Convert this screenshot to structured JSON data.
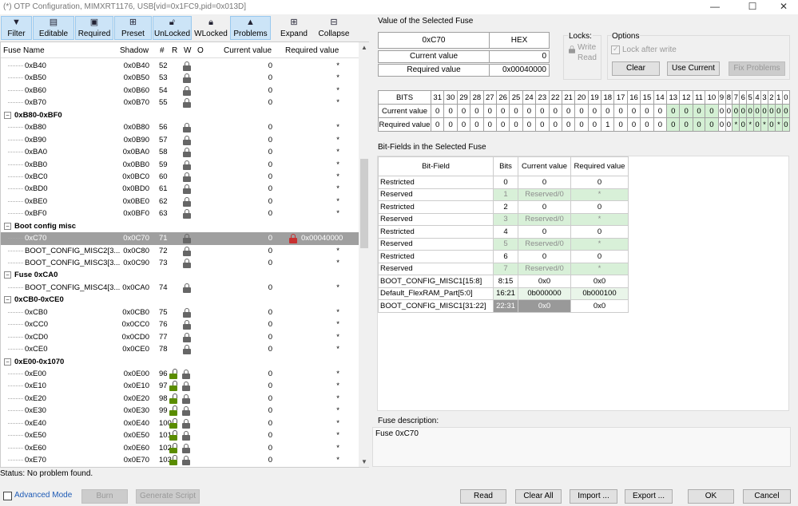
{
  "window": {
    "title": "(*) OTP Configuration, MIMXRT1176, USB[vid=0x1FC9,pid=0x013D]",
    "min": "—",
    "max": "☐",
    "close": "✕"
  },
  "toolbar": {
    "filter": "Filter",
    "editable": "Editable",
    "required": "Required",
    "preset": "Preset",
    "unlocked": "UnLocked",
    "wlocked": "WLocked",
    "problems": "Problems",
    "expand": "Expand",
    "collapse": "Collapse"
  },
  "left": {
    "headers": {
      "name": "Fuse Name",
      "shadow": "Shadow",
      "num": "#",
      "r": "R",
      "w": "W",
      "o": "O",
      "current": "Current value",
      "required": "Required value"
    },
    "rows": [
      {
        "type": "item",
        "name": "0xB40",
        "shadow": "0x0B40",
        "num": "52",
        "lock": "g0",
        "cur": "0",
        "req": "*"
      },
      {
        "type": "item",
        "name": "0xB50",
        "shadow": "0x0B50",
        "num": "53",
        "lock": "g0",
        "cur": "0",
        "req": "*"
      },
      {
        "type": "item",
        "name": "0xB60",
        "shadow": "0x0B60",
        "num": "54",
        "lock": "g0",
        "cur": "0",
        "req": "*"
      },
      {
        "type": "item",
        "name": "0xB70",
        "shadow": "0x0B70",
        "num": "55",
        "lock": "g0",
        "cur": "0",
        "req": "*"
      },
      {
        "type": "group",
        "name": "0xB80-0xBF0"
      },
      {
        "type": "item",
        "name": "0xB80",
        "shadow": "0x0B80",
        "num": "56",
        "lock": "g0",
        "cur": "0",
        "req": "*"
      },
      {
        "type": "item",
        "name": "0xB90",
        "shadow": "0x0B90",
        "num": "57",
        "lock": "g0",
        "cur": "0",
        "req": "*"
      },
      {
        "type": "item",
        "name": "0xBA0",
        "shadow": "0x0BA0",
        "num": "58",
        "lock": "g0",
        "cur": "0",
        "req": "*"
      },
      {
        "type": "item",
        "name": "0xBB0",
        "shadow": "0x0BB0",
        "num": "59",
        "lock": "g0",
        "cur": "0",
        "req": "*"
      },
      {
        "type": "item",
        "name": "0xBC0",
        "shadow": "0x0BC0",
        "num": "60",
        "lock": "g0",
        "cur": "0",
        "req": "*"
      },
      {
        "type": "item",
        "name": "0xBD0",
        "shadow": "0x0BD0",
        "num": "61",
        "lock": "g0",
        "cur": "0",
        "req": "*"
      },
      {
        "type": "item",
        "name": "0xBE0",
        "shadow": "0x0BE0",
        "num": "62",
        "lock": "g0",
        "cur": "0",
        "req": "*"
      },
      {
        "type": "item",
        "name": "0xBF0",
        "shadow": "0x0BF0",
        "num": "63",
        "lock": "g0",
        "cur": "0",
        "req": "*"
      },
      {
        "type": "group",
        "name": "Boot config misc"
      },
      {
        "type": "sel",
        "name": "0xC70",
        "shadow": "0x0C70",
        "num": "71",
        "lock": "g0",
        "cur": "0",
        "req": "0x00040000"
      },
      {
        "type": "item",
        "name": "BOOT_CONFIG_MISC2[3...",
        "shadow": "0x0C80",
        "num": "72",
        "lock": "g0",
        "cur": "0",
        "req": "*"
      },
      {
        "type": "item",
        "name": "BOOT_CONFIG_MISC3[3...",
        "shadow": "0x0C90",
        "num": "73",
        "lock": "g0",
        "cur": "0",
        "req": "*"
      },
      {
        "type": "group",
        "name": "Fuse 0xCA0"
      },
      {
        "type": "item",
        "name": "BOOT_CONFIG_MISC4[3...",
        "shadow": "0x0CA0",
        "num": "74",
        "lock": "g0",
        "cur": "0",
        "req": "*"
      },
      {
        "type": "group",
        "name": "0xCB0-0xCE0"
      },
      {
        "type": "item",
        "name": "0xCB0",
        "shadow": "0x0CB0",
        "num": "75",
        "lock": "g0",
        "cur": "0",
        "req": "*"
      },
      {
        "type": "item",
        "name": "0xCC0",
        "shadow": "0x0CC0",
        "num": "76",
        "lock": "g0",
        "cur": "0",
        "req": "*"
      },
      {
        "type": "item",
        "name": "0xCD0",
        "shadow": "0x0CD0",
        "num": "77",
        "lock": "g0",
        "cur": "0",
        "req": "*"
      },
      {
        "type": "item",
        "name": "0xCE0",
        "shadow": "0x0CE0",
        "num": "78",
        "lock": "g0",
        "cur": "0",
        "req": "*"
      },
      {
        "type": "group",
        "name": "0xE00-0x1070"
      },
      {
        "type": "item",
        "name": "0xE00",
        "shadow": "0x0E00",
        "num": "96",
        "lock": "g1",
        "cur": "0",
        "req": "*"
      },
      {
        "type": "item",
        "name": "0xE10",
        "shadow": "0x0E10",
        "num": "97",
        "lock": "g1",
        "cur": "0",
        "req": "*"
      },
      {
        "type": "item",
        "name": "0xE20",
        "shadow": "0x0E20",
        "num": "98",
        "lock": "g1",
        "cur": "0",
        "req": "*"
      },
      {
        "type": "item",
        "name": "0xE30",
        "shadow": "0x0E30",
        "num": "99",
        "lock": "g1",
        "cur": "0",
        "req": "*"
      },
      {
        "type": "item",
        "name": "0xE40",
        "shadow": "0x0E40",
        "num": "100",
        "lock": "g1",
        "cur": "0",
        "req": "*"
      },
      {
        "type": "item",
        "name": "0xE50",
        "shadow": "0x0E50",
        "num": "101",
        "lock": "g1",
        "cur": "0",
        "req": "*"
      },
      {
        "type": "item",
        "name": "0xE60",
        "shadow": "0x0E60",
        "num": "102",
        "lock": "g1",
        "cur": "0",
        "req": "*"
      },
      {
        "type": "item",
        "name": "0xE70",
        "shadow": "0x0E70",
        "num": "103",
        "lock": "g1",
        "cur": "0",
        "req": "*"
      }
    ]
  },
  "selected": {
    "group_title": "Value of the Selected Fuse",
    "address": "0xC70",
    "format": "HEX",
    "current_label": "Current value",
    "current_value": "0",
    "required_label": "Required value",
    "required_value": "0x00040000"
  },
  "locks": {
    "title": "Locks:",
    "write": "Write",
    "read": "Read"
  },
  "options": {
    "title": "Options",
    "lock_after_write": "Lock after write",
    "clear": "Clear",
    "use_current": "Use Current",
    "fix_problems": "Fix Problems"
  },
  "bits": {
    "label": "BITS",
    "current_label": "Current value",
    "required_label": "Required value",
    "numbers": [
      "31",
      "30",
      "29",
      "28",
      "27",
      "26",
      "25",
      "24",
      "23",
      "22",
      "21",
      "20",
      "19",
      "18",
      "17",
      "16",
      "15",
      "14",
      "13",
      "12",
      "11",
      "10",
      "9",
      "8",
      "7",
      "6",
      "5",
      "4",
      "3",
      "2",
      "1",
      "0"
    ],
    "current": [
      "0",
      "0",
      "0",
      "0",
      "0",
      "0",
      "0",
      "0",
      "0",
      "0",
      "0",
      "0",
      "0",
      "0",
      "0",
      "0",
      "0",
      "0",
      "0",
      "0",
      "0",
      "0",
      "0",
      "0",
      "0",
      "0",
      "0",
      "0",
      "0",
      "0",
      "0",
      "0"
    ],
    "required": [
      "0",
      "0",
      "0",
      "0",
      "0",
      "0",
      "0",
      "0",
      "0",
      "0",
      "0",
      "0",
      "0",
      "1",
      "0",
      "0",
      "0",
      "0",
      "0",
      "0",
      "0",
      "0",
      "0",
      "0",
      "*",
      "0",
      "*",
      "0",
      "*",
      "0",
      "*",
      "0"
    ]
  },
  "bitfields": {
    "title": "Bit-Fields in the Selected Fuse",
    "headers": [
      "Bit-Field",
      "Bits",
      "Current value",
      "Required value"
    ],
    "rows": [
      {
        "style": "",
        "name": "Restricted",
        "bits": "0",
        "cur": "0",
        "req": "0"
      },
      {
        "style": "rz",
        "name": "Reserved",
        "bits": "1",
        "cur": "Reserved/0",
        "req": "*"
      },
      {
        "style": "",
        "name": "Restricted",
        "bits": "2",
        "cur": "0",
        "req": "0"
      },
      {
        "style": "rz",
        "name": "Reserved",
        "bits": "3",
        "cur": "Reserved/0",
        "req": "*"
      },
      {
        "style": "",
        "name": "Restricted",
        "bits": "4",
        "cur": "0",
        "req": "0"
      },
      {
        "style": "rz",
        "name": "Reserved",
        "bits": "5",
        "cur": "Reserved/0",
        "req": "*"
      },
      {
        "style": "",
        "name": "Restricted",
        "bits": "6",
        "cur": "0",
        "req": "0"
      },
      {
        "style": "rz",
        "name": "Reserved",
        "bits": "7",
        "cur": "Reserved/0",
        "req": "*"
      },
      {
        "style": "",
        "name": "BOOT_CONFIG_MISC1[15:8]",
        "bits": "8:15",
        "cur": "0x0",
        "req": "0x0"
      },
      {
        "style": "dk",
        "name": "Default_FlexRAM_Part[5:0]",
        "bits": "16:21",
        "cur": "0b000000",
        "req": "0b000100"
      },
      {
        "style": "gy",
        "name": "BOOT_CONFIG_MISC1[31:22]",
        "bits": "22:31",
        "cur": "0x0",
        "req": "0x0"
      }
    ]
  },
  "description": {
    "title": "Fuse description:",
    "text": "Fuse 0xC70"
  },
  "status": {
    "text": "Status: No problem found."
  },
  "bottom": {
    "advanced": "Advanced Mode",
    "burn": "Burn",
    "generate": "Generate Script",
    "read": "Read",
    "clear_all": "Clear All",
    "import": "Import ...",
    "export": "Export ...",
    "ok": "OK",
    "cancel": "Cancel"
  },
  "colors": {
    "accent": "#cce4f7",
    "selected_row": "#9f9f9f",
    "green_lock": "#5a8c00",
    "reserved_bg": "#d8f0d8"
  }
}
